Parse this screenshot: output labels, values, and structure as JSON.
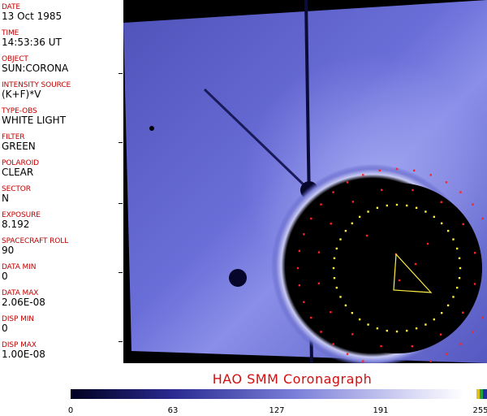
{
  "metadata": {
    "fields": [
      {
        "label": "DATE",
        "value": "13 Oct 1985"
      },
      {
        "label": "TIME",
        "value": "14:53:36 UT"
      },
      {
        "label": "OBJECT",
        "value": "SUN:CORONA"
      },
      {
        "label": "INTENSITY SOURCE",
        "value": "(K+F)*V"
      },
      {
        "label": "TYPE-OBS",
        "value": "WHITE LIGHT"
      },
      {
        "label": "FILTER",
        "value": "GREEN"
      },
      {
        "label": "POLAROID",
        "value": "CLEAR"
      },
      {
        "label": "SECTOR",
        "value": "N"
      },
      {
        "label": "EXPOSURE",
        "value": "8.192"
      },
      {
        "label": "SPACECRAFT ROLL",
        "value": "90"
      },
      {
        "label": "DATA MIN",
        "value": "0"
      },
      {
        "label": "DATA MAX",
        "value": "2.06E-08"
      },
      {
        "label": "DISP MIN",
        "value": "0"
      },
      {
        "label": "DISP MAX",
        "value": "1.00E-08"
      }
    ]
  },
  "footer": {
    "title": "HAO   SMM Coronagraph"
  },
  "colorbar": {
    "ticks": [
      "0",
      "63",
      "127",
      "191",
      "255"
    ],
    "colors": {
      "low": "#000020",
      "mid": "#5050c0",
      "high": "#ffffff"
    }
  },
  "colors": {
    "label": "#c00000",
    "accent": "#d01010",
    "corona": "#5a5ec8",
    "dots_yellow": "#ffee44",
    "dots_red": "#ff2222"
  }
}
